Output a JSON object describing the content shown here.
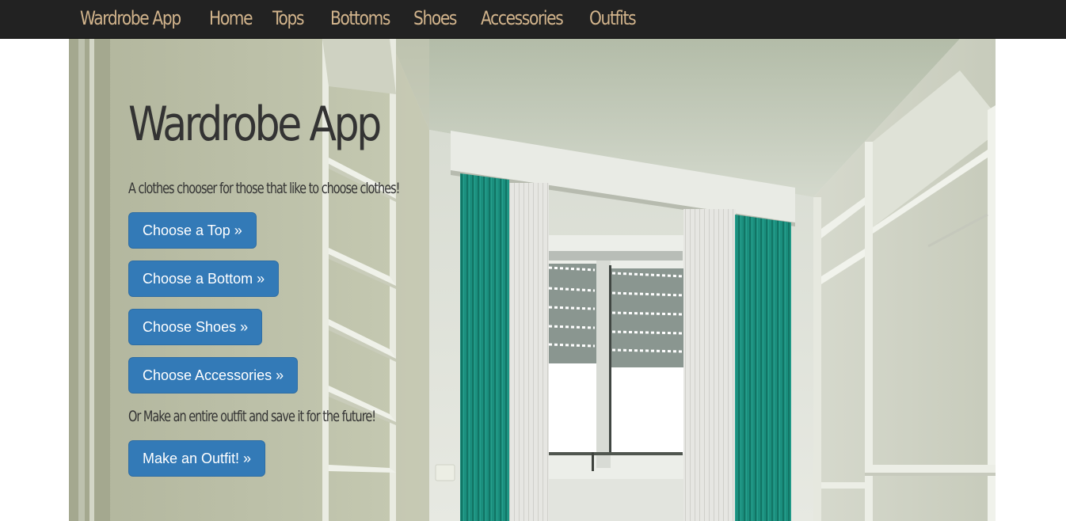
{
  "navbar": {
    "brand": "Wardrobe App",
    "links": [
      "Home",
      "Tops",
      "Bottoms",
      "Shoes",
      "Accessories",
      "Outfits"
    ]
  },
  "hero": {
    "title": "Wardrobe App",
    "subtitle": "A clothes chooser for those that like to choose clothes!",
    "buttons": {
      "top": "Choose a Top »",
      "bottom": "Choose a Bottom »",
      "shoes": "Choose Shoes »",
      "accessories": "Choose Accessories »",
      "outfit": "Make an Outfit! »"
    },
    "outfit_prompt": "Or Make an entire outfit and save it for the future!"
  },
  "colors": {
    "navbar_bg": "#222222",
    "nav_link": "#d2b48c",
    "button_primary": "#337ab7",
    "curtain": "#1a8f7e"
  }
}
